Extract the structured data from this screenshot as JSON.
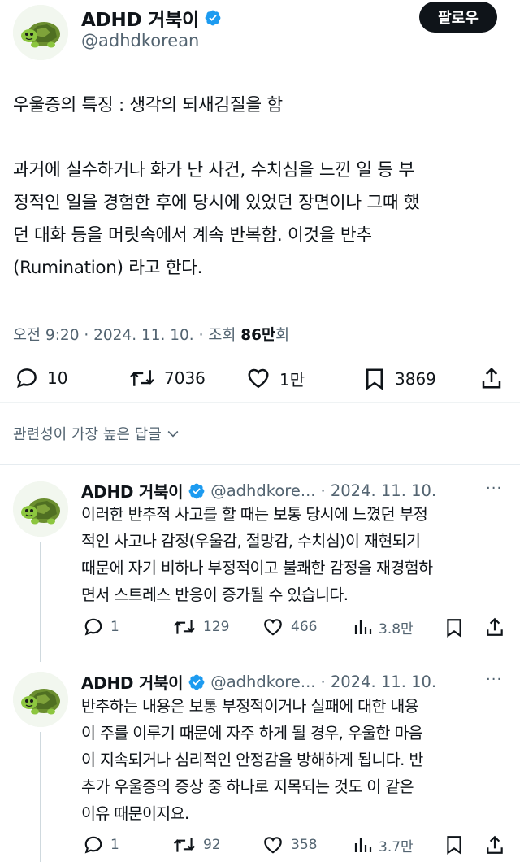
{
  "main_tweet": {
    "display_name": "ADHD 거북이",
    "handle": "@adhdkorean",
    "follow_label": "팔로우",
    "text": "우울증의 특징 : 생각의 되새김질을 함\n\n과거에 실수하거나 화가 난 사건, 수치심을 느낀 일 등 부\n정적인 일을 경험한 후에 당시에 있었던 장면이나 그때 했\n던 대화 등을 머릿속에서 계속 반복함. 이것을 반추\n(Rumination) 라고 한다.",
    "time": "오전 9:20",
    "date": "2024. 11. 10.",
    "views_prefix": "조회",
    "views_count": "86만",
    "views_suffix": "회",
    "actions": {
      "replies": "10",
      "retweets": "7036",
      "likes": "1만",
      "bookmarks": "3869"
    }
  },
  "sort_label": "관련성이 가장 높은 답글",
  "replies": [
    {
      "display_name": "ADHD 거북이",
      "handle": "@adhdkore...",
      "date": "· 2024. 11. 10.",
      "text": "이러한 반추적 사고를 할 때는 보통 당시에 느꼈던 부정\n적인 사고나 감정(우울감, 절망감, 수치심)이 재현되기\n때문에 자기 비하나 부정적이고 불쾌한 감정을 재경험하\n면서 스트레스 반응이 증가될 수 있습니다.",
      "replies": "1",
      "retweets": "129",
      "likes": "466",
      "views": "3.8만"
    },
    {
      "display_name": "ADHD 거북이",
      "handle": "@adhdkore...",
      "date": "· 2024. 11. 10.",
      "text": "반추하는 내용은 보통 부정적이거나 실패에 대한 내용\n이 주를 이루기 때문에 자주 하게 될 경우, 우울한 마음\n이 지속되거나 심리적인 안정감을 방해하게 됩니다. 반\n추가 우울증의 증상 중 하나로 지목되는 것도 이 같은\n이유 때문이지요.",
      "replies": "1",
      "retweets": "92",
      "likes": "358",
      "views": "3.7만"
    }
  ],
  "colors": {
    "text": "#0f1419",
    "secondary": "#536471",
    "verified": "#1d9bf0",
    "divider": "#eff3f4"
  }
}
